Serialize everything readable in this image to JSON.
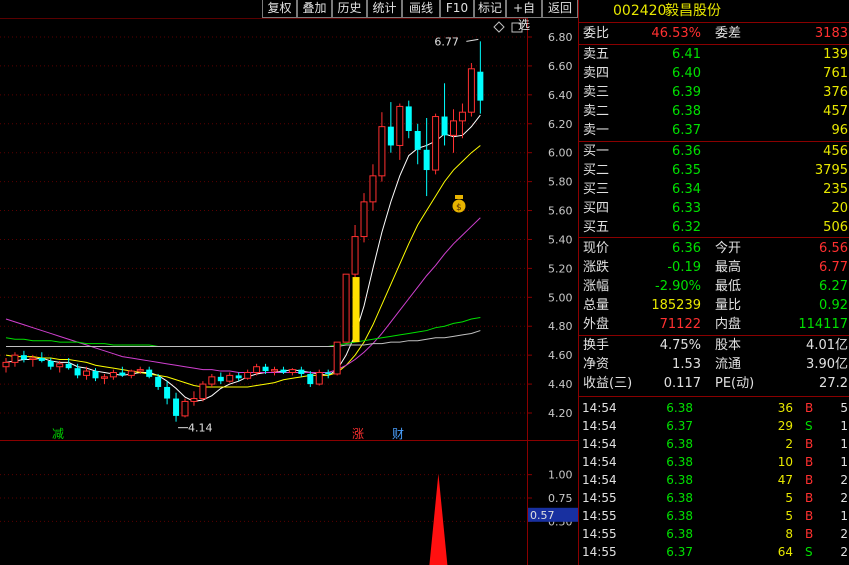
{
  "toolbar": [
    "复权",
    "叠加",
    "历史",
    "统计",
    "画线",
    "F10",
    "标记",
    "+自选",
    "返回"
  ],
  "stock": {
    "code": "002420",
    "name": "毅昌股份"
  },
  "weibi": {
    "label": "委比",
    "value": "46.53%",
    "label2": "委差",
    "value2": "3183"
  },
  "asks": [
    {
      "label": "卖五",
      "price": "6.41",
      "vol": "139"
    },
    {
      "label": "卖四",
      "price": "6.40",
      "vol": "761"
    },
    {
      "label": "卖三",
      "price": "6.39",
      "vol": "376"
    },
    {
      "label": "卖二",
      "price": "6.38",
      "vol": "457"
    },
    {
      "label": "卖一",
      "price": "6.37",
      "vol": "96"
    }
  ],
  "bids": [
    {
      "label": "买一",
      "price": "6.36",
      "vol": "456"
    },
    {
      "label": "买二",
      "price": "6.35",
      "vol": "3795"
    },
    {
      "label": "买三",
      "price": "6.34",
      "vol": "235"
    },
    {
      "label": "买四",
      "price": "6.33",
      "vol": "20"
    },
    {
      "label": "买五",
      "price": "6.32",
      "vol": "506"
    }
  ],
  "stats": [
    {
      "l1": "现价",
      "v1": "6.36",
      "c1": "grn",
      "l2": "今开",
      "v2": "6.56",
      "c2": "red"
    },
    {
      "l1": "涨跌",
      "v1": "-0.19",
      "c1": "grn",
      "l2": "最高",
      "v2": "6.77",
      "c2": "red"
    },
    {
      "l1": "涨幅",
      "v1": "-2.90%",
      "c1": "grn",
      "l2": "最低",
      "v2": "6.27",
      "c2": "grn"
    },
    {
      "l1": "总量",
      "v1": "185239",
      "c1": "yel",
      "l2": "量比",
      "v2": "0.92",
      "c2": "grn"
    },
    {
      "l1": "外盘",
      "v1": "71122",
      "c1": "red",
      "l2": "内盘",
      "v2": "114117",
      "c2": "grn"
    }
  ],
  "stats2": [
    {
      "l1": "换手",
      "v1": "4.75%",
      "l2": "股本",
      "v2": "4.01亿"
    },
    {
      "l1": "净资",
      "v1": "1.53",
      "l2": "流通",
      "v2": "3.90亿"
    },
    {
      "l1": "收益(三)",
      "v1": "0.117",
      "l2": "PE(动)",
      "v2": "27.2"
    }
  ],
  "trades": [
    {
      "time": "14:54",
      "price": "6.38",
      "vol": "36",
      "dir": "B",
      "num": "5"
    },
    {
      "time": "14:54",
      "price": "6.37",
      "vol": "29",
      "dir": "S",
      "num": "1"
    },
    {
      "time": "14:54",
      "price": "6.38",
      "vol": "2",
      "dir": "B",
      "num": "1"
    },
    {
      "time": "14:54",
      "price": "6.38",
      "vol": "10",
      "dir": "B",
      "num": "1"
    },
    {
      "time": "14:54",
      "price": "6.38",
      "vol": "47",
      "dir": "B",
      "num": "2"
    },
    {
      "time": "14:55",
      "price": "6.38",
      "vol": "5",
      "dir": "B",
      "num": "2"
    },
    {
      "time": "14:55",
      "price": "6.38",
      "vol": "5",
      "dir": "B",
      "num": "1"
    },
    {
      "time": "14:55",
      "price": "6.38",
      "vol": "8",
      "dir": "B",
      "num": "2"
    },
    {
      "time": "14:55",
      "price": "6.37",
      "vol": "64",
      "dir": "S",
      "num": "2"
    }
  ],
  "chart_data": {
    "type": "candlestick",
    "price_axis": [
      "6.80",
      "6.60",
      "6.40",
      "6.20",
      "6.00",
      "5.80",
      "5.60",
      "5.40",
      "5.20",
      "5.00",
      "4.80",
      "4.60",
      "4.40",
      "4.20"
    ],
    "ylim": [
      4.12,
      6.84
    ],
    "high_label": "6.77",
    "low_label": "4.14",
    "markers": [
      {
        "text": "减",
        "color": "#00d000"
      },
      {
        "text": "涨",
        "color": "#ff3030"
      },
      {
        "text": "财",
        "color": "#4aa0ff"
      }
    ],
    "candles": [
      [
        4.52,
        4.58,
        4.48,
        4.55
      ],
      [
        4.55,
        4.62,
        4.52,
        4.6
      ],
      [
        4.6,
        4.63,
        4.55,
        4.57
      ],
      [
        4.57,
        4.6,
        4.52,
        4.58
      ],
      [
        4.58,
        4.62,
        4.55,
        4.56
      ],
      [
        4.56,
        4.58,
        4.5,
        4.52
      ],
      [
        4.52,
        4.56,
        4.48,
        4.54
      ],
      [
        4.54,
        4.58,
        4.5,
        4.51
      ],
      [
        4.51,
        4.54,
        4.44,
        4.46
      ],
      [
        4.46,
        4.52,
        4.43,
        4.49
      ],
      [
        4.49,
        4.51,
        4.42,
        4.44
      ],
      [
        4.44,
        4.47,
        4.4,
        4.45
      ],
      [
        4.45,
        4.5,
        4.43,
        4.48
      ],
      [
        4.48,
        4.52,
        4.45,
        4.46
      ],
      [
        4.46,
        4.5,
        4.44,
        4.49
      ],
      [
        4.49,
        4.52,
        4.47,
        4.5
      ],
      [
        4.5,
        4.52,
        4.44,
        4.45
      ],
      [
        4.45,
        4.47,
        4.36,
        4.38
      ],
      [
        4.38,
        4.42,
        4.26,
        4.3
      ],
      [
        4.3,
        4.34,
        4.14,
        4.18
      ],
      [
        4.18,
        4.3,
        4.17,
        4.28
      ],
      [
        4.28,
        4.35,
        4.25,
        4.3
      ],
      [
        4.3,
        4.42,
        4.28,
        4.4
      ],
      [
        4.4,
        4.47,
        4.38,
        4.45
      ],
      [
        4.45,
        4.48,
        4.4,
        4.42
      ],
      [
        4.42,
        4.48,
        4.41,
        4.46
      ],
      [
        4.46,
        4.48,
        4.42,
        4.44
      ],
      [
        4.44,
        4.5,
        4.43,
        4.48
      ],
      [
        4.48,
        4.54,
        4.46,
        4.52
      ],
      [
        4.52,
        4.54,
        4.47,
        4.49
      ],
      [
        4.49,
        4.52,
        4.46,
        4.5
      ],
      [
        4.5,
        4.52,
        4.47,
        4.48
      ],
      [
        4.48,
        4.51,
        4.46,
        4.5
      ],
      [
        4.5,
        4.52,
        4.45,
        4.47
      ],
      [
        4.47,
        4.49,
        4.38,
        4.4
      ],
      [
        4.4,
        4.5,
        4.39,
        4.48
      ],
      [
        4.48,
        4.5,
        4.44,
        4.47
      ],
      [
        4.47,
        4.69,
        4.46,
        4.69
      ],
      [
        4.69,
        5.16,
        4.69,
        5.16
      ],
      [
        5.16,
        5.5,
        5.12,
        5.42
      ],
      [
        5.42,
        5.72,
        5.38,
        5.66
      ],
      [
        5.66,
        5.92,
        5.6,
        5.84
      ],
      [
        5.84,
        6.28,
        5.8,
        6.18
      ],
      [
        6.18,
        6.35,
        6.0,
        6.05
      ],
      [
        6.05,
        6.34,
        5.95,
        6.32
      ],
      [
        6.32,
        6.36,
        6.1,
        6.15
      ],
      [
        6.15,
        6.2,
        5.92,
        6.02
      ],
      [
        6.02,
        6.24,
        5.7,
        5.88
      ],
      [
        5.88,
        6.27,
        5.85,
        6.25
      ],
      [
        6.25,
        6.48,
        6.05,
        6.12
      ],
      [
        6.12,
        6.3,
        6.0,
        6.22
      ],
      [
        6.22,
        6.34,
        6.1,
        6.28
      ],
      [
        6.28,
        6.62,
        6.25,
        6.58
      ],
      [
        6.56,
        6.77,
        6.27,
        6.36
      ]
    ],
    "ma_lines": [
      {
        "color": "#ffffff",
        "values": [
          4.55,
          4.56,
          4.57,
          4.57,
          4.58,
          4.56,
          4.55,
          4.55,
          4.52,
          4.51,
          4.49,
          4.48,
          4.47,
          4.46,
          4.47,
          4.48,
          4.48,
          4.46,
          4.42,
          4.37,
          4.31,
          4.28,
          4.29,
          4.32,
          4.37,
          4.4,
          4.42,
          4.45,
          4.47,
          4.48,
          4.48,
          4.49,
          4.5,
          4.49,
          4.48,
          4.47,
          4.46,
          4.5,
          4.6,
          4.74,
          4.94,
          5.2,
          5.45,
          5.66,
          5.84,
          5.98,
          6.03,
          6.05,
          6.08,
          6.13,
          6.11,
          6.12,
          6.18,
          6.26
        ]
      },
      {
        "color": "#ffff00",
        "values": [
          4.6,
          4.59,
          4.59,
          4.59,
          4.58,
          4.58,
          4.57,
          4.57,
          4.56,
          4.55,
          4.53,
          4.52,
          4.51,
          4.5,
          4.49,
          4.48,
          4.47,
          4.46,
          4.45,
          4.43,
          4.41,
          4.39,
          4.38,
          4.38,
          4.38,
          4.38,
          4.38,
          4.38,
          4.39,
          4.4,
          4.41,
          4.43,
          4.44,
          4.45,
          4.46,
          4.46,
          4.46,
          4.48,
          4.53,
          4.6,
          4.69,
          4.81,
          4.95,
          5.09,
          5.23,
          5.37,
          5.5,
          5.6,
          5.7,
          5.8,
          5.88,
          5.94,
          6.0,
          6.05
        ]
      },
      {
        "color": "#d040d0",
        "values": [
          4.85,
          4.83,
          4.81,
          4.79,
          4.77,
          4.75,
          4.73,
          4.71,
          4.69,
          4.67,
          4.65,
          4.63,
          4.61,
          4.59,
          4.58,
          4.57,
          4.56,
          4.55,
          4.54,
          4.53,
          4.52,
          4.51,
          4.5,
          4.5,
          4.49,
          4.49,
          4.48,
          4.48,
          4.48,
          4.48,
          4.48,
          4.48,
          4.48,
          4.48,
          4.48,
          4.48,
          4.48,
          4.5,
          4.53,
          4.57,
          4.62,
          4.68,
          4.75,
          4.83,
          4.91,
          4.99,
          5.07,
          5.15,
          5.22,
          5.3,
          5.37,
          5.43,
          5.49,
          5.55
        ]
      },
      {
        "color": "#00e000",
        "values": [
          4.72,
          4.71,
          4.71,
          4.7,
          4.7,
          4.7,
          4.69,
          4.69,
          4.69,
          4.68,
          4.68,
          4.68,
          4.67,
          4.67,
          4.67,
          4.67,
          4.67,
          4.66,
          4.66,
          4.66,
          4.66,
          4.66,
          4.66,
          4.66,
          4.66,
          4.66,
          4.66,
          4.66,
          4.66,
          4.66,
          4.66,
          4.66,
          4.66,
          4.66,
          4.66,
          4.66,
          4.66,
          4.67,
          4.68,
          4.69,
          4.7,
          4.71,
          4.72,
          4.73,
          4.74,
          4.75,
          4.76,
          4.77,
          4.79,
          4.8,
          4.82,
          4.83,
          4.85,
          4.86
        ]
      },
      {
        "color": "#c0c0c0",
        "values": [
          4.66,
          4.66,
          4.66,
          4.66,
          4.66,
          4.66,
          4.66,
          4.66,
          4.66,
          4.66,
          4.66,
          4.66,
          4.66,
          4.66,
          4.66,
          4.66,
          4.66,
          4.66,
          4.66,
          4.66,
          4.66,
          4.66,
          4.66,
          4.66,
          4.66,
          4.66,
          4.66,
          4.66,
          4.66,
          4.66,
          4.66,
          4.66,
          4.66,
          4.66,
          4.66,
          4.66,
          4.66,
          4.66,
          4.67,
          4.67,
          4.67,
          4.68,
          4.68,
          4.69,
          4.69,
          4.7,
          4.7,
          4.71,
          4.72,
          4.72,
          4.73,
          4.74,
          4.75,
          4.77
        ]
      }
    ],
    "lower_axis": [
      "1.00",
      "0.75",
      "0.50"
    ],
    "lower_ylim": [
      0.0,
      1.05
    ],
    "lower_value": "0.57",
    "lower_signal_index": 52,
    "lower_signal_value": 1.0
  }
}
